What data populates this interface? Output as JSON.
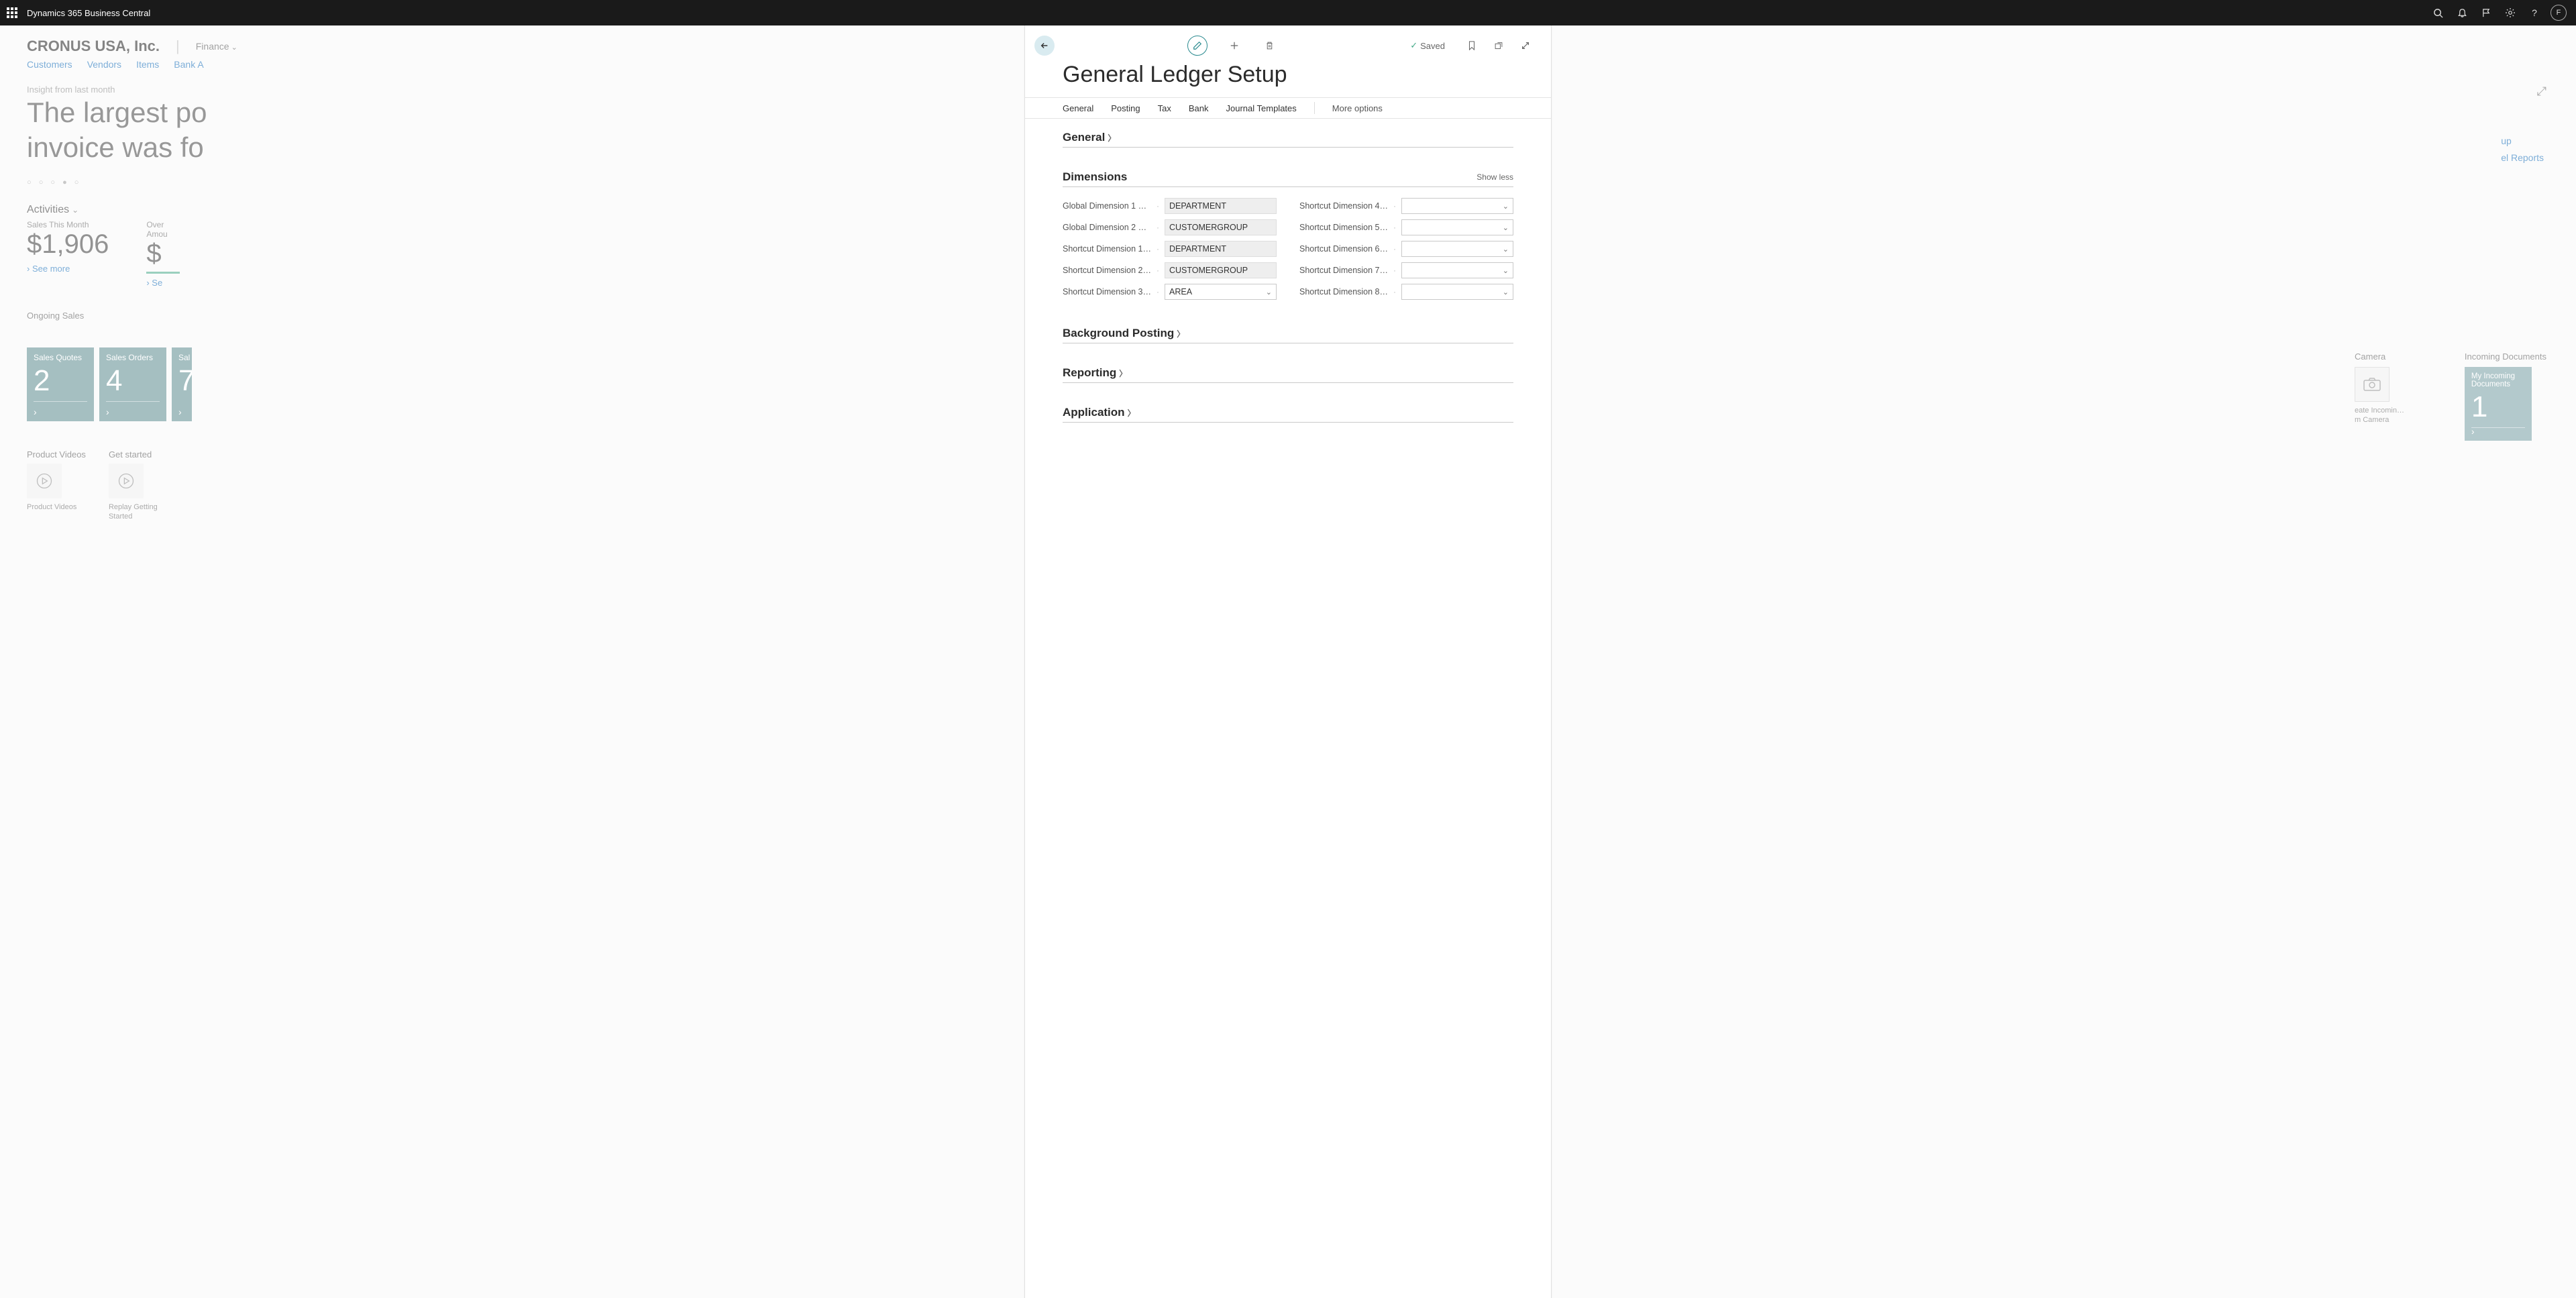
{
  "app": {
    "title": "Dynamics 365 Business Central",
    "avatar_initial": "F"
  },
  "workspace": {
    "company": "CRONUS USA, Inc.",
    "menu": "Finance",
    "tabs": [
      "Customers",
      "Vendors",
      "Items",
      "Bank A"
    ],
    "insight_label": "Insight from last month",
    "big_line1": "The largest po",
    "big_line2": "invoice was fo",
    "dots": "○ ○ ○ ● ○",
    "activities_label": "Activities",
    "kpis": [
      {
        "label": "Sales This Month",
        "value": "$1,906"
      },
      {
        "label": "Over\nAmou",
        "value": "$"
      }
    ],
    "see_more": "See more",
    "ongoing_label": "Ongoing Sales",
    "tiles": [
      {
        "label": "Sales Quotes",
        "num": "2"
      },
      {
        "label": "Sales Orders",
        "num": "4"
      },
      {
        "label": "Sal",
        "num": "7"
      }
    ],
    "camera_label": "Camera",
    "camera_action": "eate Incomin…\nm Camera",
    "incoming_label": "Incoming Documents",
    "incoming_tile_label": "My Incoming\nDocuments",
    "incoming_tile_num": "1",
    "right_links": [
      "up",
      "el Reports"
    ],
    "pv_label": "Product Videos",
    "pv_caption": "Product Videos",
    "gs_label": "Get started",
    "gs_caption": "Replay Getting\nStarted"
  },
  "panel": {
    "saved": "Saved",
    "title": "General Ledger Setup",
    "tabs": [
      "General",
      "Posting",
      "Tax",
      "Bank",
      "Journal Templates"
    ],
    "more": "More options",
    "fasttabs": {
      "general": "General",
      "dimensions": "Dimensions",
      "show_less": "Show less",
      "bg_posting": "Background Posting",
      "reporting": "Reporting",
      "application": "Application"
    },
    "dim_fields_left": [
      {
        "label": "Global Dimension 1 C…",
        "value": "DEPARTMENT",
        "readonly": true
      },
      {
        "label": "Global Dimension 2 C…",
        "value": "CUSTOMERGROUP",
        "readonly": true
      },
      {
        "label": "Shortcut Dimension 1…",
        "value": "DEPARTMENT",
        "readonly": true
      },
      {
        "label": "Shortcut Dimension 2…",
        "value": "CUSTOMERGROUP",
        "readonly": true
      },
      {
        "label": "Shortcut Dimension 3…",
        "value": "AREA",
        "readonly": false
      }
    ],
    "dim_fields_right": [
      {
        "label": "Shortcut Dimension 4…",
        "value": "",
        "readonly": false
      },
      {
        "label": "Shortcut Dimension 5…",
        "value": "",
        "readonly": false
      },
      {
        "label": "Shortcut Dimension 6…",
        "value": "",
        "readonly": false
      },
      {
        "label": "Shortcut Dimension 7…",
        "value": "",
        "readonly": false
      },
      {
        "label": "Shortcut Dimension 8…",
        "value": "",
        "readonly": false
      }
    ]
  }
}
